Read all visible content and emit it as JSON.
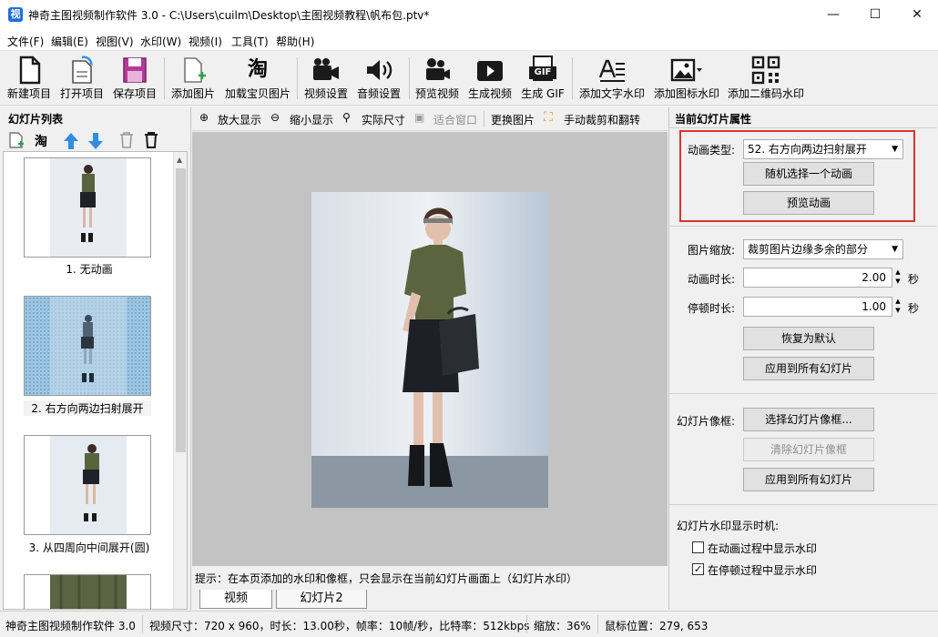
{
  "window": {
    "app_icon": "视",
    "title": "神奇主图视频制作软件 3.0 - C:\\Users\\cuilm\\Desktop\\主图视频教程\\帆布包.ptv*",
    "minimize": "—",
    "maximize": "☐",
    "close": "✕"
  },
  "menu": [
    "文件(F)",
    "编辑(E)",
    "视图(V)",
    "水印(W)",
    "视频(I)",
    "工具(T)",
    "帮助(H)"
  ],
  "toolbar": {
    "new_project": "新建项目",
    "open_project": "打开项目",
    "save_project": "保存项目",
    "add_image": "添加图片",
    "load_taobao": "加载宝贝图片",
    "video_settings": "视频设置",
    "audio_settings": "音频设置",
    "preview_video": "预览视频",
    "generate_video": "生成视频",
    "generate_gif": "生成 GIF",
    "add_text_watermark": "添加文字水印",
    "add_icon_watermark": "添加图标水印",
    "add_qr_watermark": "添加二维码水印",
    "taobao_glyph": "淘",
    "gif_glyph": "GIF"
  },
  "left_panel": {
    "title": "幻灯片列表",
    "taobao_glyph": "淘",
    "slides": [
      {
        "caption": "1. 无动画"
      },
      {
        "caption": "2. 右方向两边扫射展开"
      },
      {
        "caption": "3. 从四周向中间展开(圆)"
      }
    ]
  },
  "center": {
    "zoom_in": "放大显示",
    "zoom_out": "缩小显示",
    "actual_size": "实际尺寸",
    "fit_window": "适合窗口",
    "replace_image": "更换图片",
    "crop_rotate": "手动裁剪和翻转",
    "hint": "提示：在本页添加的水印和像框，只会显示在当前幻灯片画面上（幻灯片水印）",
    "tabs": [
      "视频",
      "幻灯片2"
    ]
  },
  "right_panel": {
    "title": "当前幻灯片属性",
    "animation_type_label": "动画类型:",
    "animation_type_value": "52. 右方向两边扫射展开",
    "random_animation": "随机选择一个动画",
    "preview_animation": "预览动画",
    "image_scale_label": "图片缩放:",
    "image_scale_value": "裁剪图片边缘多余的部分",
    "anim_duration_label": "动画时长:",
    "anim_duration_value": "2.00",
    "pause_duration_label": "停顿时长:",
    "pause_duration_value": "1.00",
    "seconds_unit": "秒",
    "restore_default": "恢复为默认",
    "apply_all_1": "应用到所有幻灯片",
    "frame_label": "幻灯片像框:",
    "choose_frame": "选择幻灯片像框...",
    "clear_frame": "清除幻灯片像框",
    "apply_all_2": "应用到所有幻灯片",
    "watermark_timing_label": "幻灯片水印显示时机:",
    "show_during_animation": "在动画过程中显示水印",
    "show_during_animation_checked": false,
    "show_during_pause": "在停顿过程中显示水印",
    "show_during_pause_checked": true,
    "check_mark": "✓"
  },
  "status": {
    "app": "神奇主图视频制作软件 3.0",
    "info": "视频尺寸：720 x 960，时长：13.00秒，帧率：10帧/秒，比特率：512kbps",
    "zoom": "缩放：36%",
    "mouse": "鼠标位置：279, 653"
  },
  "colors": {
    "accent_blue": "#2f8de4",
    "highlight_red": "#e03030",
    "icon_dark": "#1a1a1a"
  }
}
